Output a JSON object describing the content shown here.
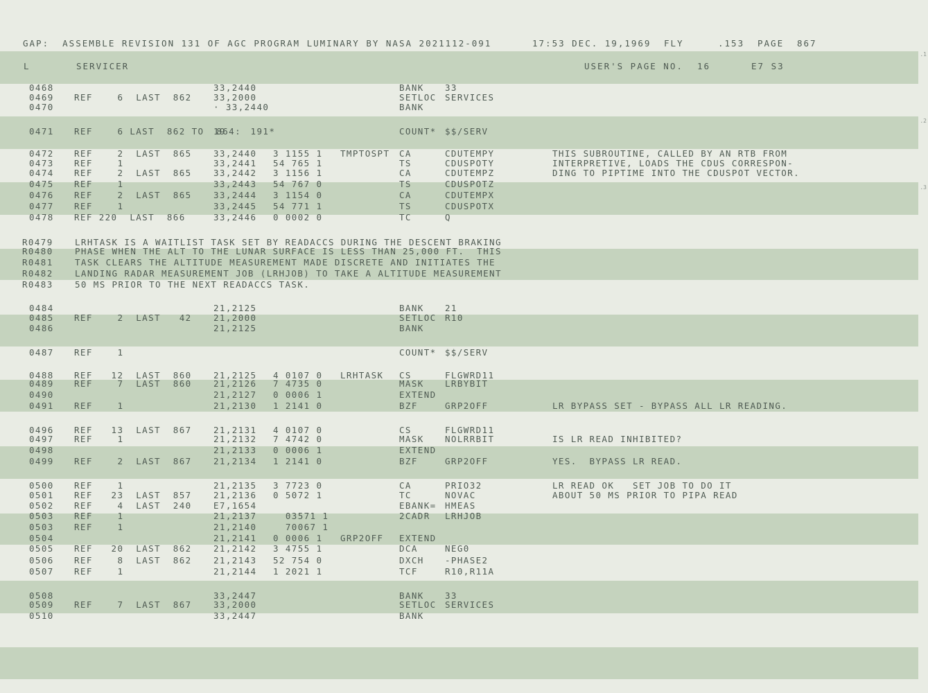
{
  "header": {
    "title": "GAP:  ASSEMBLE REVISION 131 OF AGC PROGRAM LUMINARY BY NASA 2021112-091",
    "timestamp": "17:53 DEC. 19,1969",
    "mode": "FLY",
    "sheet": ".153",
    "page_label": "PAGE",
    "page_number": "867"
  },
  "subheader": {
    "letter": "L",
    "section": "SERVICER",
    "user_page_label": "USER'S PAGE NO.",
    "user_page_number": "16",
    "codes": "E7 S3"
  },
  "margin_marks": [
    ".1",
    ".2",
    ".3"
  ],
  "rows": [
    {
      "line": "0468",
      "ref": "",
      "addr": "33,2440",
      "word": "",
      "label": "",
      "op": "BANK",
      "operand": "33",
      "comment": ""
    },
    {
      "line": "0469",
      "ref": "REF    6  LAST  862",
      "addr": "33,2000",
      "word": "",
      "label": "",
      "op": "SETLOC",
      "operand": "SERVICES",
      "comment": ""
    },
    {
      "line": "0470",
      "ref": "",
      "addr": "· 33,2440",
      "word": "",
      "label": "",
      "op": "BANK",
      "operand": "",
      "comment": ""
    },
    {
      "line": "0471",
      "ref": "REF    6 LAST  862 TO  864:",
      "addr": "19    191*",
      "word": "",
      "label": "",
      "op": "COUNT*",
      "operand": "$$/SERV",
      "comment": ""
    },
    {
      "line": "0472",
      "ref": "REF    2  LAST  865",
      "addr": "33,2440",
      "word": "3 1155 1",
      "label": "TMPTOSPT",
      "op": "CA",
      "operand": "CDUTEMPY",
      "comment": "THIS SUBROUTINE, CALLED BY AN RTB FROM"
    },
    {
      "line": "0473",
      "ref": "REF    1",
      "addr": "33,2441",
      "word": "54 765 1",
      "label": "",
      "op": "TS",
      "operand": "CDUSPOTY",
      "comment": "INTERPRETIVE, LOADS THE CDUS CORRESPON-"
    },
    {
      "line": "0474",
      "ref": "REF    2  LAST  865",
      "addr": "33,2442",
      "word": "3 1156 1",
      "label": "",
      "op": "CA",
      "operand": "CDUTEMPZ",
      "comment": "DING TO PIPTIME INTO THE CDUSPOT VECTOR."
    },
    {
      "line": "0475",
      "ref": "REF    1",
      "addr": "33,2443",
      "word": "54 767 0",
      "label": "",
      "op": "TS",
      "operand": "CDUSPOTZ",
      "comment": ""
    },
    {
      "line": "0476",
      "ref": "REF    2  LAST  865",
      "addr": "33,2444",
      "word": "3 1154 0",
      "label": "",
      "op": "CA",
      "operand": "CDUTEMPX",
      "comment": ""
    },
    {
      "line": "0477",
      "ref": "REF    1",
      "addr": "33,2445",
      "word": "54 771 1",
      "label": "",
      "op": "TS",
      "operand": "CDUSPOTX",
      "comment": ""
    },
    {
      "line": "0478",
      "ref": "REF 220  LAST  866",
      "addr": "33,2446",
      "word": "0 0002 0",
      "label": "",
      "op": "TC",
      "operand": "Q",
      "comment": ""
    },
    {
      "remark": "R0479",
      "text": "LRHTASK IS A WAITLIST TASK SET BY READACCS DURING THE DESCENT BRAKING"
    },
    {
      "remark": "R0480",
      "text": "PHASE WHEN THE ALT TO THE LUNAR SURFACE IS LESS THAN 25,000 FT.  THIS"
    },
    {
      "remark": "R0481",
      "text": "TASK CLEARS THE ALTITUDE MEASUREMENT MADE DISCRETE AND INITIATES THE"
    },
    {
      "remark": "R0482",
      "text": "LANDING RADAR MEASUREMENT JOB (LRHJOB) TO TAKE A ALTITUDE MEASUREMENT"
    },
    {
      "remark": "R0483",
      "text": "50 MS PRIOR TO THE NEXT READACCS TASK."
    },
    {
      "line": "0484",
      "ref": "",
      "addr": "21,2125",
      "word": "",
      "label": "",
      "op": "BANK",
      "operand": "21",
      "comment": ""
    },
    {
      "line": "0485",
      "ref": "REF    2  LAST   42",
      "addr": "21,2000",
      "word": "",
      "label": "",
      "op": "SETLOC",
      "operand": "R10",
      "comment": ""
    },
    {
      "line": "0486",
      "ref": "",
      "addr": "21,2125",
      "word": "",
      "label": "",
      "op": "BANK",
      "operand": "",
      "comment": ""
    },
    {
      "line": "0487",
      "ref": "REF    1",
      "addr": "",
      "word": "",
      "label": "",
      "op": "COUNT*",
      "operand": "$$/SERV",
      "comment": ""
    },
    {
      "line": "0488",
      "ref": "REF   12  LAST  860",
      "addr": "21,2125",
      "word": "4 0107 0",
      "label": "LRHTASK",
      "op": "CS",
      "operand": "FLGWRD11",
      "comment": ""
    },
    {
      "line": "0489",
      "ref": "REF    7  LAST  860",
      "addr": "21,2126",
      "word": "7 4735 0",
      "label": "",
      "op": "MASK",
      "operand": "LRBYBIT",
      "comment": ""
    },
    {
      "line": "0490",
      "ref": "",
      "addr": "21,2127",
      "word": "0 0006 1",
      "label": "",
      "op": "EXTEND",
      "operand": "",
      "comment": ""
    },
    {
      "line": "0491",
      "ref": "REF    1",
      "addr": "21,2130",
      "word": "1 2141 0",
      "label": "",
      "op": "BZF",
      "operand": "GRP2OFF",
      "comment": "LR BYPASS SET - BYPASS ALL LR READING."
    },
    {
      "line": "0496",
      "ref": "REF   13  LAST  867",
      "addr": "21,2131",
      "word": "4 0107 0",
      "label": "",
      "op": "CS",
      "operand": "FLGWRD11",
      "comment": ""
    },
    {
      "line": "0497",
      "ref": "REF    1",
      "addr": "21,2132",
      "word": "7 4742 0",
      "label": "",
      "op": "MASK",
      "operand": "NOLRRBIT",
      "comment": "IS LR READ INHIBITED?"
    },
    {
      "line": "0498",
      "ref": "",
      "addr": "21,2133",
      "word": "0 0006 1",
      "label": "",
      "op": "EXTEND",
      "operand": "",
      "comment": ""
    },
    {
      "line": "0499",
      "ref": "REF    2  LAST  867",
      "addr": "21,2134",
      "word": "1 2141 0",
      "label": "",
      "op": "BZF",
      "operand": "GRP2OFF",
      "comment": "YES.  BYPASS LR READ."
    },
    {
      "line": "0500",
      "ref": "REF    1",
      "addr": "21,2135",
      "word": "3 7723 0",
      "label": "",
      "op": "CA",
      "operand": "PRIO32",
      "comment": "LR READ OK   SET JOB TO DO IT"
    },
    {
      "line": "0501",
      "ref": "REF   23  LAST  857",
      "addr": "21,2136",
      "word": "0 5072 1",
      "label": "",
      "op": "TC",
      "operand": "NOVAC",
      "comment": "ABOUT 50 MS PRIOR TO PIPA READ"
    },
    {
      "line": "0502",
      "ref": "REF    4  LAST  240",
      "addr": "E7,1654",
      "word": "",
      "label": "",
      "op": "EBANK=",
      "operand": "HMEAS",
      "comment": ""
    },
    {
      "line": "0503",
      "ref": "REF    1",
      "addr": "21,2137",
      "word": "  03571 1",
      "label": "",
      "op": "2CADR",
      "operand": "LRHJOB",
      "comment": ""
    },
    {
      "line": "0503",
      "ref": "REF    1",
      "addr": "21,2140",
      "word": "  70067 1",
      "label": "",
      "op": "",
      "operand": "",
      "comment": ""
    },
    {
      "line": "0504",
      "ref": "",
      "addr": "21,2141",
      "word": "0 0006 1",
      "label": "GRP2OFF",
      "op": "EXTEND",
      "operand": "",
      "comment": ""
    },
    {
      "line": "0505",
      "ref": "REF   20  LAST  862",
      "addr": "21,2142",
      "word": "3 4755 1",
      "label": "",
      "op": "DCA",
      "operand": "NEG0",
      "comment": ""
    },
    {
      "line": "0506",
      "ref": "REF    8  LAST  862",
      "addr": "21,2143",
      "word": "52 754 0",
      "label": "",
      "op": "DXCH",
      "operand": "-PHASE2",
      "comment": ""
    },
    {
      "line": "0507",
      "ref": "REF    1",
      "addr": "21,2144",
      "word": "1 2021 1",
      "label": "",
      "op": "TCF",
      "operand": "R10,R11A",
      "comment": ""
    },
    {
      "line": "0508",
      "ref": "",
      "addr": "33,2447",
      "word": "",
      "label": "",
      "op": "BANK",
      "operand": "33",
      "comment": ""
    },
    {
      "line": "0509",
      "ref": "REF    7  LAST  867",
      "addr": "33,2000",
      "word": "",
      "label": "",
      "op": "SETLOC",
      "operand": "SERVICES",
      "comment": ""
    },
    {
      "line": "0510",
      "ref": "",
      "addr": "33,2447",
      "word": "",
      "label": "",
      "op": "BANK",
      "operand": "",
      "comment": ""
    }
  ]
}
